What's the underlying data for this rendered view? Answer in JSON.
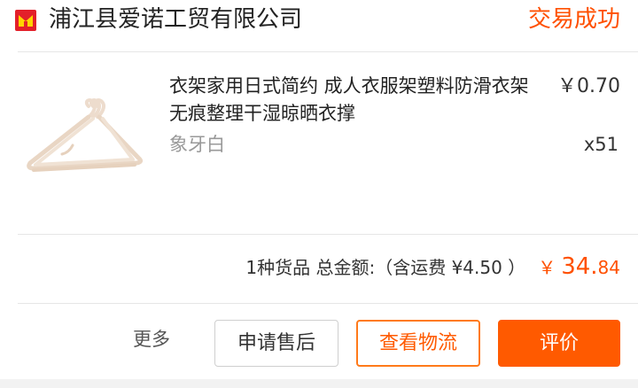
{
  "colors": {
    "accent": "#ff5000",
    "text_primary": "#222222",
    "text_secondary": "#999999",
    "divider": "#e6e6e6"
  },
  "header": {
    "store_icon": "tmall-shop-icon",
    "store_name": "浦江县爱诺工贸有限公司",
    "status": "交易成功"
  },
  "product": {
    "image_icon": "clothes-hanger-image",
    "title": "衣架家用日式简约 成人衣服架塑料防滑衣架 无痕整理干湿晾晒衣撑",
    "sku": "象牙白",
    "unit_price": "￥0.70",
    "quantity": "x51"
  },
  "summary": {
    "text": "1种货品 总金额:（含运费 ¥4.50 ）",
    "currency": "￥",
    "total_int": "34.",
    "total_dec": "84"
  },
  "actions": {
    "more": "更多",
    "after_sales": "申请售后",
    "view_logistics": "查看物流",
    "review": "评价"
  }
}
